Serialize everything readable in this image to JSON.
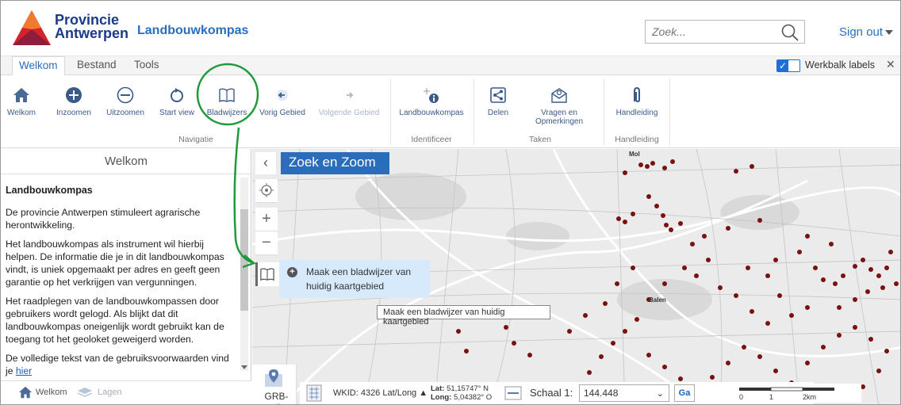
{
  "header": {
    "brand_line1": "Provincie",
    "brand_line2": "Antwerpen",
    "app_title": "Landbouwkompas",
    "search_placeholder": "Zoek...",
    "sign_out": "Sign out"
  },
  "tabs": [
    {
      "label": "Welkom",
      "active": true
    },
    {
      "label": "Bestand",
      "active": false
    },
    {
      "label": "Tools",
      "active": false
    }
  ],
  "toolbar_labels": {
    "label": "Werkbalk labels",
    "checked": true
  },
  "ribbon": {
    "buttons": [
      {
        "label": "Welkom",
        "icon": "home-icon"
      },
      {
        "label": "Inzoomen",
        "icon": "plus-circle-icon"
      },
      {
        "label": "Uitzoomen",
        "icon": "minus-circle-icon"
      },
      {
        "label": "Start view",
        "icon": "refresh-icon"
      },
      {
        "label": "Bladwijzers",
        "icon": "book-icon"
      },
      {
        "label": "Vorig Gebied",
        "icon": "arrow-left-icon"
      },
      {
        "label": "Volgende Gebied",
        "icon": "arrow-right-icon",
        "disabled": true
      },
      {
        "label": "Landbouwkompas",
        "icon": "info-icon"
      },
      {
        "label": "Delen",
        "icon": "share-icon"
      },
      {
        "label": "Vragen en",
        "label2": "Opmerkingen",
        "icon": "envelope-icon"
      },
      {
        "label": "Handleiding",
        "icon": "paperclip-icon"
      }
    ],
    "groups": {
      "navigatie": "Navigatie",
      "identificeer": "Identificeer",
      "taken": "Taken",
      "handleiding": "Handleiding"
    }
  },
  "left_panel": {
    "title": "Welkom",
    "heading": "Landbouwkompas",
    "paragraphs": [
      "De provincie Antwerpen stimuleert agrarische herontwikkeling.",
      "Het landbouwkompas als instrument wil hierbij helpen. De informatie die je in dit landbouwkompas vindt, is uniek opgemaakt per adres en geeft geen garantie op het verkrijgen van vergunningen.",
      "Het raadplegen van de landbouwkompassen door gebruikers wordt gelogd. Als blijkt dat dit landbouwkompas oneigenlijk wordt gebruikt kan de toegang tot het geoloket geweigerd worden.",
      "De volledige tekst van de gebruiksvoorwaarden vind je "
    ],
    "link_text": "hier",
    "footer": {
      "welkom": "Welkom",
      "lagen": "Lagen"
    }
  },
  "map": {
    "zoek_en_zoom": "Zoek en Zoom",
    "bookmark_popup": "Maak een bladwijzer van huidig kaartgebied",
    "tooltip": "Maak een bladwijzer van huidig kaartgebied",
    "town_mol": "Mol",
    "town_balen": "Balen",
    "basemap": "GRB-grijs",
    "wkid": "WKID: 4326 Lat/Long ▲",
    "lat_label": "Lat:",
    "lat_value": "51,15747° N",
    "long_label": "Long:",
    "long_value": "5,04382° O",
    "scale_label": "Schaal 1:",
    "scale_value": "144.448",
    "ga": "Ga",
    "scalebar_ticks": [
      "0",
      "1",
      "2km"
    ]
  },
  "colors": {
    "accent": "#2a6ebb",
    "brand_red": "#d4232a",
    "point": "#7a1010",
    "annotation_green": "#1f9a3a"
  }
}
